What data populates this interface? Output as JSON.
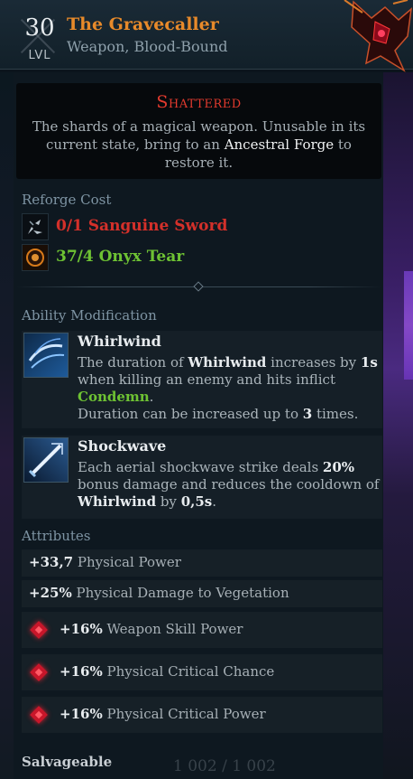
{
  "header": {
    "level": "30",
    "level_label": "LVL",
    "name": "The Gravecaller",
    "type": "Weapon, Blood-Bound"
  },
  "shattered": {
    "title": "Shattered",
    "desc_before": "The shards of a magical weapon. Unusable in its current state, bring to an ",
    "desc_highlight": "Ancestral Forge",
    "desc_after": " to restore it."
  },
  "reforge": {
    "title": "Reforge Cost",
    "items": [
      {
        "text": "0/1  Sanguine Sword",
        "icon": "sword-shard-icon",
        "status": "insufficient"
      },
      {
        "text": "37/4  Onyx Tear",
        "icon": "onyx-tear-icon",
        "status": "sufficient"
      }
    ]
  },
  "ability_mod": {
    "title": "Ability Modification",
    "abilities": [
      {
        "name": "Whirlwind",
        "icon": "whirlwind-icon",
        "p1": "The duration of ",
        "p2": "Whirlwind",
        "p3": " increases by ",
        "p4": "1s",
        "p5": " when killing an enemy and hits inflict ",
        "p6": "Condemn",
        "p7": ".",
        "p8": "Duration can be increased up to ",
        "p9": "3",
        "p10": " times."
      },
      {
        "name": "Shockwave",
        "icon": "shockwave-icon",
        "p1": "Each aerial shockwave strike deals ",
        "p2": "20%",
        "p3": " bonus damage and reduces the cooldown of ",
        "p4": "Whirlwind",
        "p5": " by ",
        "p6": "0,5s",
        "p7": "."
      }
    ]
  },
  "attributes": {
    "title": "Attributes",
    "items": [
      {
        "value": "+33,7",
        "label": " Physical Power",
        "icon": ""
      },
      {
        "value": "+25%",
        "label": " Physical Damage to Vegetation",
        "icon": ""
      },
      {
        "value": "+16%",
        "label": " Weapon Skill Power",
        "icon": "blood-rune-icon"
      },
      {
        "value": "+16%",
        "label": " Physical Critical Chance",
        "icon": "blood-rune-icon"
      },
      {
        "value": "+16%",
        "label": " Physical Critical Power",
        "icon": "blood-rune-icon"
      }
    ]
  },
  "footer": {
    "salvage": "Salvageable",
    "durability": "1 002 / 1 002"
  },
  "colors": {
    "name": "#e88a2a",
    "shattered": "#e33a2e",
    "insufficient": "#d4302a",
    "sufficient": "#6ec233"
  }
}
